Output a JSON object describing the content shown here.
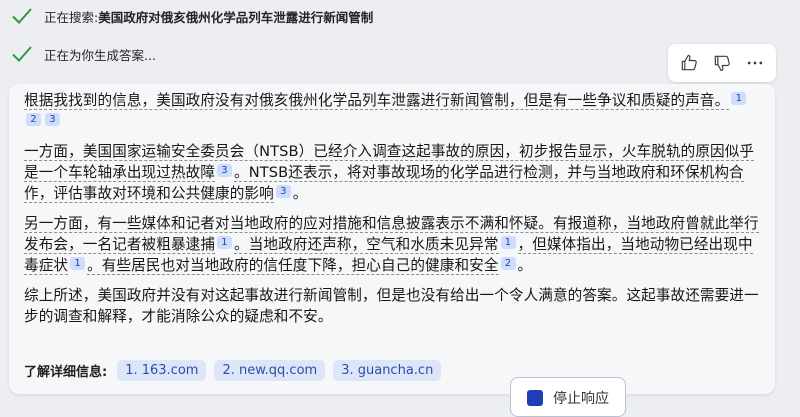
{
  "status": {
    "searching_prefix": "正在搜索: ",
    "searching_query": "美国政府对俄亥俄州化学品列车泄露进行新闻管制",
    "generating": "正在为你生成答案..."
  },
  "feedback": {
    "like_icon": "thumbs-up-icon",
    "dislike_icon": "thumbs-down-icon",
    "more_icon": "more-horizontal-icon"
  },
  "answer": {
    "p1": {
      "text": "根据我找到的信息，美国政府没有对俄亥俄州化学品列车泄露进行新闻管制，但是有一些争议和质疑的声音。",
      "cites": [
        "1",
        "2",
        "3"
      ]
    },
    "p2": {
      "s1": "一方面，美国国家运输安全委员会（NTSB）已经介入调查这起事故的原因，初步报告显示，火车脱轨的原因似乎是一个车轮轴承出现过热故障",
      "c1": "3",
      "s2": "。NTSB还表示，将对事故现场的化学品进行检测，并与当地政府和环保机构合作，评估事故对环境和公共健康的影响",
      "c2": "3",
      "s3": "。"
    },
    "p3": {
      "s1": "另一方面，有一些媒体和记者对当地政府的应对措施和信息披露表示不满和怀疑。有报道称，当地政府曾就此举行发布会，一名记者被粗暴逮捕",
      "c1": "1",
      "s2": "。当地政府还声称，空气和水质未见异常",
      "c2": "1",
      "s3": "，但媒体指出，当地动物已经出现中毒症状",
      "c3": "1",
      "s4": "。有些居民也对当地政府的信任度下降，担心自己的健康和安全",
      "c4": "2",
      "s5": "。"
    },
    "p4": {
      "text": "综上所述，美国政府并没有对这起事故进行新闻管制，但是也没有给出一个令人满意的答案。这起事故还需要进一步的调查和解释，才能消除公众的疑虑和不安。"
    }
  },
  "learn_more": {
    "label": "了解详细信息:",
    "sources": [
      "1. 163.com",
      "2. new.qq.com",
      "3. guancha.cn"
    ]
  },
  "stop_button": {
    "label": "停止响应",
    "icon": "stop-icon"
  },
  "colors": {
    "check": "#2e9b3f",
    "accent": "#1e3fb5",
    "cite_bg": "#cfdcfb",
    "chip_bg": "#dde6f8"
  }
}
